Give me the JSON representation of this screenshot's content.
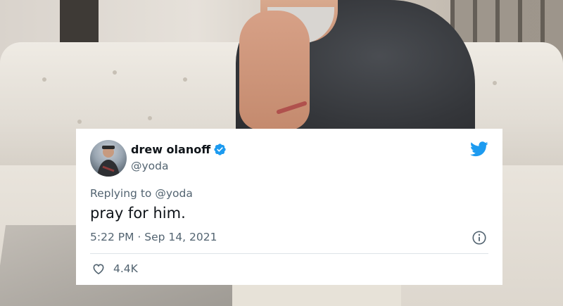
{
  "tweet": {
    "display_name": "drew olanoff",
    "handle": "@yoda",
    "replying_prefix": "Replying to",
    "replying_to": "@yoda",
    "text": "pray for him.",
    "time": "5:22 PM",
    "separator": "·",
    "date": "Sep 14, 2021",
    "like_count": "4.4K",
    "verified": true
  },
  "icons": {
    "verified": "verified-badge-icon",
    "brand": "twitter-bird-icon",
    "info": "info-icon",
    "like": "heart-icon"
  },
  "colors": {
    "brand_blue": "#1d9bf0",
    "text_primary": "#0f1419",
    "text_secondary": "#536471",
    "divider": "#dde3e7"
  }
}
